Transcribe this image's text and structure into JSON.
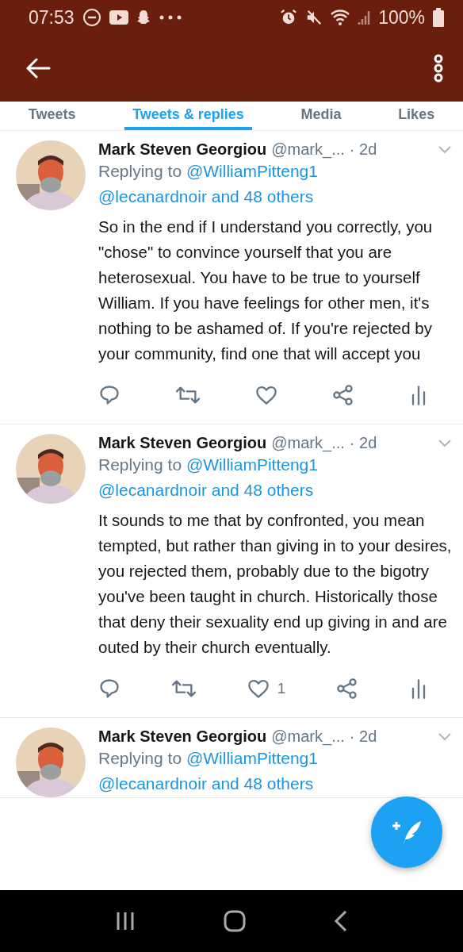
{
  "status_bar": {
    "time": "07:53",
    "battery": "100%"
  },
  "tabs": [
    {
      "label": "Tweets",
      "selected": false
    },
    {
      "label": "Tweets & replies",
      "selected": true
    },
    {
      "label": "Media",
      "selected": false
    },
    {
      "label": "Likes",
      "selected": false
    }
  ],
  "tweets": [
    {
      "author": "Mark Steven Georgiou",
      "handle": "@mark_...",
      "time": "· 2d",
      "replying_prefix": "Replying to",
      "reply_to": "@WilliamPitteng1",
      "reply_others": "@lecanardnoir and 48 others",
      "text": "So in the end if I understand you correctly, you \"chose\" to convince yourself that you are heterosexual. You have to be true to yourself William. If you have feelings for other men, it's nothing to be ashamed of. If you're rejected by your community, find one that will accept you"
    },
    {
      "author": "Mark Steven Georgiou",
      "handle": "@mark_...",
      "time": "· 2d",
      "replying_prefix": "Replying to",
      "reply_to": "@WilliamPitteng1",
      "reply_others": "@lecanardnoir and 48 others",
      "text": "It sounds to me that by confronted, you mean tempted, but rather than giving in to your desires, you rejected them, probably due to the bigotry you've been taught in church. Historically those that deny their sexuality end up giving in and are outed by their church eventually.",
      "like_count": "1"
    },
    {
      "author": "Mark Steven Georgiou",
      "handle": "@mark_...",
      "time": "· 2d",
      "replying_prefix": "Replying to",
      "reply_to": "@WilliamPitteng1",
      "reply_others": "@lecanardnoir and 48 others"
    }
  ]
}
